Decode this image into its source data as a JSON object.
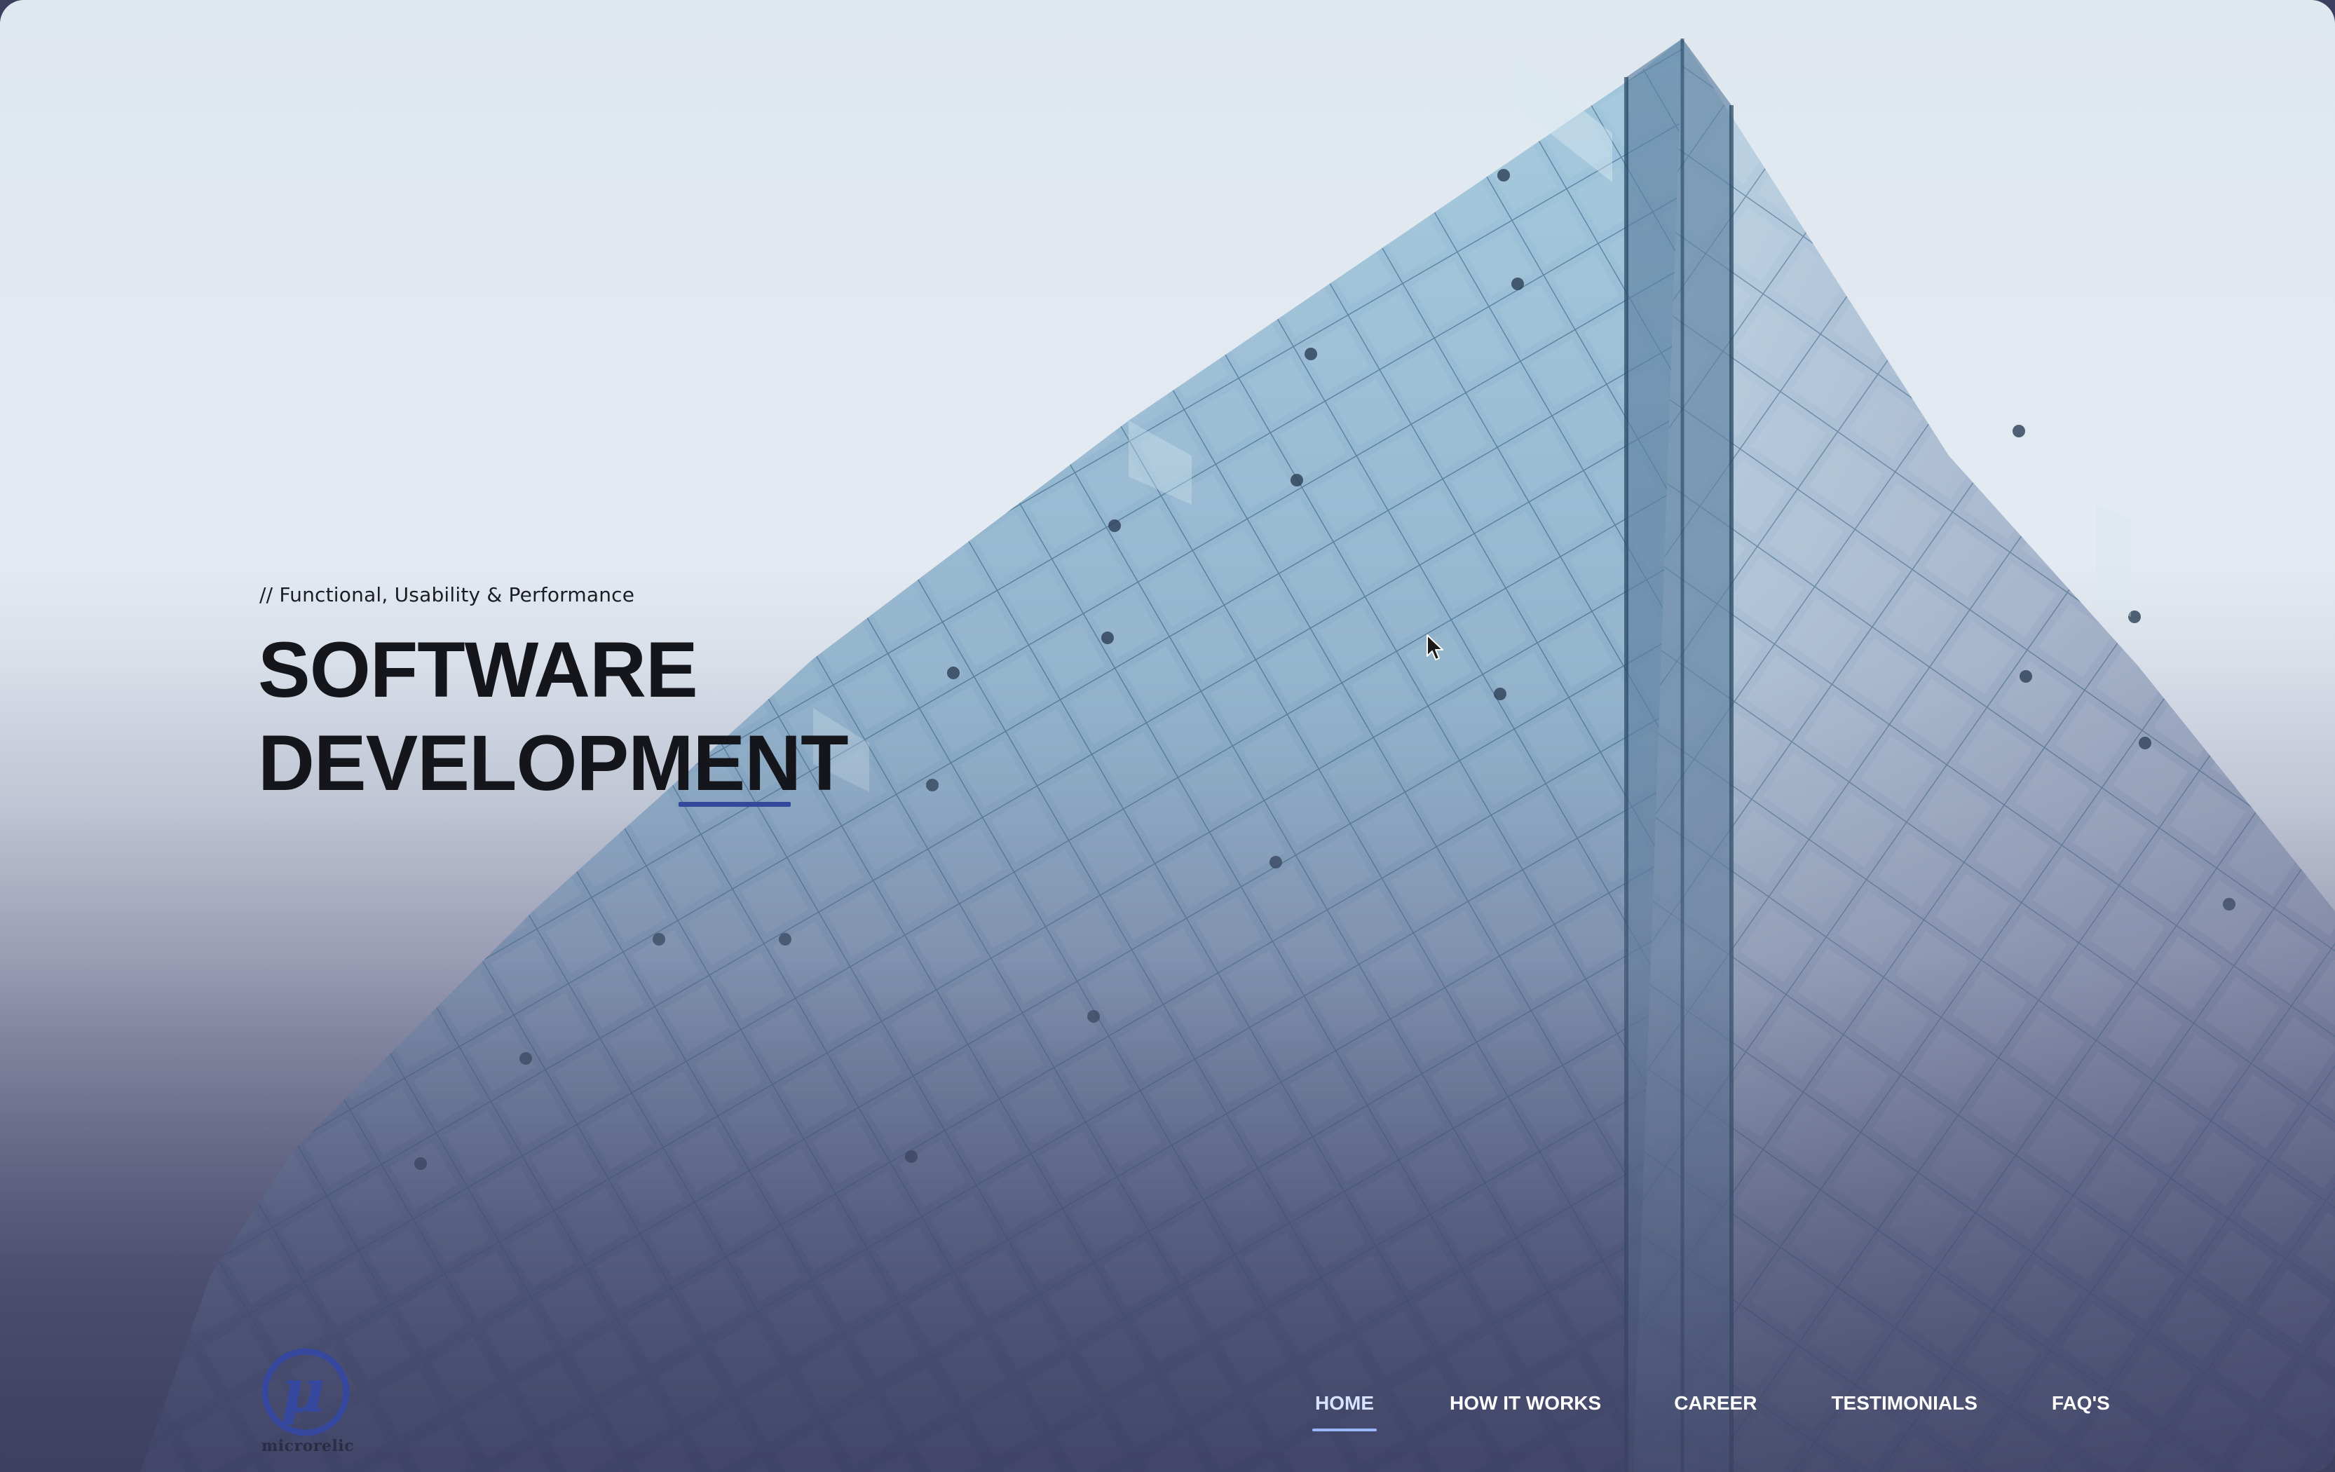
{
  "hero": {
    "tagline": "// Functional, Usability & Performance",
    "title_line1": "SOFTWARE",
    "title_line2": "DEVELOPMENT"
  },
  "brand": {
    "logo_symbol": "μ",
    "logo_text": "microrelic"
  },
  "nav": {
    "items": [
      {
        "label": "HOME",
        "active": true
      },
      {
        "label": "HOW IT WORKS",
        "active": false
      },
      {
        "label": "CAREER",
        "active": false
      },
      {
        "label": "TESTIMONIALS",
        "active": false
      },
      {
        "label": "FAQ'S",
        "active": false
      }
    ]
  },
  "colors": {
    "accent": "#34489b",
    "title": "#15161c",
    "nav_text": "#ffffff",
    "sky": "#dfe7ef",
    "dusk": "#3f4163"
  }
}
